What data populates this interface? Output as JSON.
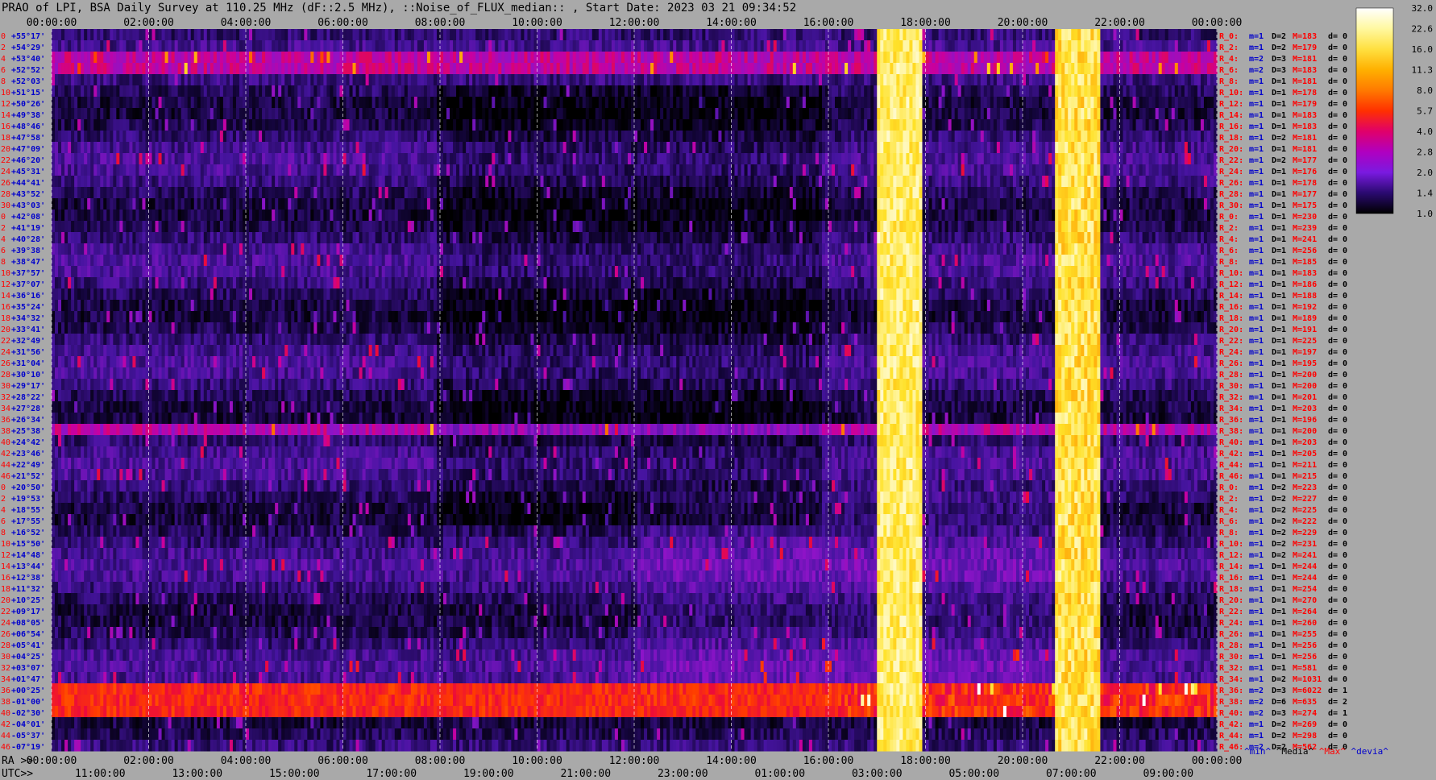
{
  "title": "PRAO of LPI, BSA Daily Survey at 110.25 MHz (dF::2.5 MHz), ::Noise_of_FLUX_median:: , Start Date: 2023 03 21 09:34:52",
  "colors": {
    "background": "#a9a9a9",
    "max_label": "#ff0000",
    "min_label": "#0000cc",
    "beam_number": "#ff0000",
    "dec_label": "#0000cc"
  },
  "chart_data": {
    "type": "heatmap",
    "top_axis_ticks": [
      "00:00:00",
      "02:00:00",
      "04:00:00",
      "06:00:00",
      "08:00:00",
      "10:00:00",
      "12:00:00",
      "14:00:00",
      "16:00:00",
      "18:00:00",
      "20:00:00",
      "22:00:00",
      "00:00:00"
    ],
    "ra_axis_prefix": "RA >>",
    "ra_axis_ticks": [
      "00:00:00",
      "02:00:00",
      "04:00:00",
      "06:00:00",
      "08:00:00",
      "10:00:00",
      "12:00:00",
      "14:00:00",
      "16:00:00",
      "18:00:00",
      "20:00:00",
      "22:00:00",
      "00:00:00"
    ],
    "utc_axis_prefix": "UTC>>",
    "utc_axis_ticks": [
      "11:00:00",
      "13:00:00",
      "15:00:00",
      "17:00:00",
      "19:00:00",
      "21:00:00",
      "23:00:00",
      "01:00:00",
      "03:00:00",
      "05:00:00",
      "07:00:00",
      "09:00:00"
    ],
    "colorbar": {
      "ticks": [
        "32.0",
        "22.6",
        "16.0",
        "11.3",
        "8.0",
        "5.7",
        "4.0",
        "2.8",
        "2.0",
        "1.4",
        "1.0"
      ],
      "colors": [
        "#ffffff",
        "#fff8a0",
        "#ffe040",
        "#ffb000",
        "#ff7a00",
        "#ff3000",
        "#e0006a",
        "#b000c0",
        "#7a1ae0",
        "#2a0a70",
        "#000000"
      ]
    },
    "declinations": [
      "+55°17'",
      "+54°29'",
      "+53°40'",
      "+52°52'",
      "+52°03'",
      "+51°15'",
      "+50°26'",
      "+49°38'",
      "+48°46'",
      "+47°58'",
      "+47°09'",
      "+46°20'",
      "+45°31'",
      "+44°41'",
      "+43°52'",
      "+43°03'",
      "+42°08'",
      "+41°19'",
      "+40°28'",
      "+39°38'",
      "+38°47'",
      "+37°57'",
      "+37°07'",
      "+36°16'",
      "+35°24'",
      "+34°32'",
      "+33°41'",
      "+32°49'",
      "+31°56'",
      "+31°04'",
      "+30°10'",
      "+29°17'",
      "+28°22'",
      "+27°28'",
      "+26°34'",
      "+25°38'",
      "+24°42'",
      "+23°46'",
      "+22°49'",
      "+21°52'",
      "+20°50'",
      "+19°53'",
      "+18°55'",
      "+17°55'",
      "+16°52'",
      "+15°50'",
      "+14°48'",
      "+13°44'",
      "+12°38'",
      "+11°32'",
      "+10°25'",
      "+09°17'",
      "+08°05'",
      "+06°54'",
      "+05°41'",
      "+04°25'",
      "+03°07'",
      "+01°47'",
      "+00°25'",
      "-01°00'",
      "-02°30'",
      "-04°01'",
      "-05°37'",
      "-07°19'"
    ],
    "beam_numbers": [
      "0",
      "2",
      "4",
      "6",
      "8",
      "10",
      "12",
      "14",
      "16",
      "18",
      "20",
      "22",
      "24",
      "26",
      "28",
      "30",
      "0",
      "2",
      "4",
      "6",
      "8",
      "10",
      "12",
      "14",
      "16",
      "18",
      "20",
      "22",
      "24",
      "26",
      "28",
      "30",
      "32",
      "34",
      "36",
      "38",
      "40",
      "42",
      "44",
      "46",
      "0",
      "2",
      "4",
      "6",
      "8",
      "10",
      "12",
      "14",
      "16",
      "18",
      "20",
      "22",
      "24",
      "26",
      "28",
      "30",
      "32",
      "34",
      "36",
      "38",
      "40",
      "42",
      "44",
      "46"
    ],
    "stats": [
      {
        "r": "R_0:",
        "m": "m=1",
        "D": "D=2",
        "M": "M=183",
        "d": "d= 0"
      },
      {
        "r": "R_2:",
        "m": "m=1",
        "D": "D=2",
        "M": "M=179",
        "d": "d= 0"
      },
      {
        "r": "R_4:",
        "m": "m=2",
        "D": "D=3",
        "M": "M=181",
        "d": "d= 0"
      },
      {
        "r": "R_6:",
        "m": "m=2",
        "D": "D=3",
        "M": "M=183",
        "d": "d= 0"
      },
      {
        "r": "R_8:",
        "m": "m=1",
        "D": "D=1",
        "M": "M=181",
        "d": "d= 0"
      },
      {
        "r": "R_10:",
        "m": "m=1",
        "D": "D=1",
        "M": "M=178",
        "d": "d= 0"
      },
      {
        "r": "R_12:",
        "m": "m=1",
        "D": "D=1",
        "M": "M=179",
        "d": "d= 0"
      },
      {
        "r": "R_14:",
        "m": "m=1",
        "D": "D=1",
        "M": "M=183",
        "d": "d= 0"
      },
      {
        "r": "R_16:",
        "m": "m=1",
        "D": "D=1",
        "M": "M=183",
        "d": "d= 0"
      },
      {
        "r": "R_18:",
        "m": "m=1",
        "D": "D=2",
        "M": "M=181",
        "d": "d= 0"
      },
      {
        "r": "R_20:",
        "m": "m=1",
        "D": "D=1",
        "M": "M=181",
        "d": "d= 0"
      },
      {
        "r": "R_22:",
        "m": "m=1",
        "D": "D=2",
        "M": "M=177",
        "d": "d= 0"
      },
      {
        "r": "R_24:",
        "m": "m=1",
        "D": "D=1",
        "M": "M=176",
        "d": "d= 0"
      },
      {
        "r": "R_26:",
        "m": "m=1",
        "D": "D=1",
        "M": "M=178",
        "d": "d= 0"
      },
      {
        "r": "R_28:",
        "m": "m=1",
        "D": "D=1",
        "M": "M=177",
        "d": "d= 0"
      },
      {
        "r": "R_30:",
        "m": "m=1",
        "D": "D=1",
        "M": "M=175",
        "d": "d= 0"
      },
      {
        "r": "R_0:",
        "m": "m=1",
        "D": "D=1",
        "M": "M=230",
        "d": "d= 0"
      },
      {
        "r": "R_2:",
        "m": "m=1",
        "D": "D=1",
        "M": "M=239",
        "d": "d= 0"
      },
      {
        "r": "R_4:",
        "m": "m=1",
        "D": "D=1",
        "M": "M=241",
        "d": "d= 0"
      },
      {
        "r": "R_6:",
        "m": "m=1",
        "D": "D=1",
        "M": "M=256",
        "d": "d= 0"
      },
      {
        "r": "R_8:",
        "m": "m=1",
        "D": "D=1",
        "M": "M=185",
        "d": "d= 0"
      },
      {
        "r": "R_10:",
        "m": "m=1",
        "D": "D=1",
        "M": "M=183",
        "d": "d= 0"
      },
      {
        "r": "R_12:",
        "m": "m=1",
        "D": "D=1",
        "M": "M=186",
        "d": "d= 0"
      },
      {
        "r": "R_14:",
        "m": "m=1",
        "D": "D=1",
        "M": "M=188",
        "d": "d= 0"
      },
      {
        "r": "R_16:",
        "m": "m=1",
        "D": "D=1",
        "M": "M=192",
        "d": "d= 0"
      },
      {
        "r": "R_18:",
        "m": "m=1",
        "D": "D=1",
        "M": "M=189",
        "d": "d= 0"
      },
      {
        "r": "R_20:",
        "m": "m=1",
        "D": "D=1",
        "M": "M=191",
        "d": "d= 0"
      },
      {
        "r": "R_22:",
        "m": "m=1",
        "D": "D=1",
        "M": "M=225",
        "d": "d= 0"
      },
      {
        "r": "R_24:",
        "m": "m=1",
        "D": "D=1",
        "M": "M=197",
        "d": "d= 0"
      },
      {
        "r": "R_26:",
        "m": "m=1",
        "D": "D=1",
        "M": "M=195",
        "d": "d= 0"
      },
      {
        "r": "R_28:",
        "m": "m=1",
        "D": "D=1",
        "M": "M=200",
        "d": "d= 0"
      },
      {
        "r": "R_30:",
        "m": "m=1",
        "D": "D=1",
        "M": "M=200",
        "d": "d= 0"
      },
      {
        "r": "R_32:",
        "m": "m=1",
        "D": "D=1",
        "M": "M=201",
        "d": "d= 0"
      },
      {
        "r": "R_34:",
        "m": "m=1",
        "D": "D=1",
        "M": "M=203",
        "d": "d= 0"
      },
      {
        "r": "R_36:",
        "m": "m=1",
        "D": "D=1",
        "M": "M=196",
        "d": "d= 0"
      },
      {
        "r": "R_38:",
        "m": "m=1",
        "D": "D=1",
        "M": "M=200",
        "d": "d= 0"
      },
      {
        "r": "R_40:",
        "m": "m=1",
        "D": "D=1",
        "M": "M=203",
        "d": "d= 0"
      },
      {
        "r": "R_42:",
        "m": "m=1",
        "D": "D=1",
        "M": "M=205",
        "d": "d= 0"
      },
      {
        "r": "R_44:",
        "m": "m=1",
        "D": "D=1",
        "M": "M=211",
        "d": "d= 0"
      },
      {
        "r": "R_46:",
        "m": "m=1",
        "D": "D=1",
        "M": "M=215",
        "d": "d= 0"
      },
      {
        "r": "R_0:",
        "m": "m=1",
        "D": "D=2",
        "M": "M=223",
        "d": "d= 0"
      },
      {
        "r": "R_2:",
        "m": "m=1",
        "D": "D=2",
        "M": "M=227",
        "d": "d= 0"
      },
      {
        "r": "R_4:",
        "m": "m=1",
        "D": "D=2",
        "M": "M=225",
        "d": "d= 0"
      },
      {
        "r": "R_6:",
        "m": "m=1",
        "D": "D=2",
        "M": "M=222",
        "d": "d= 0"
      },
      {
        "r": "R_8:",
        "m": "m=1",
        "D": "D=2",
        "M": "M=229",
        "d": "d= 0"
      },
      {
        "r": "R_10:",
        "m": "m=1",
        "D": "D=2",
        "M": "M=231",
        "d": "d= 0"
      },
      {
        "r": "R_12:",
        "m": "m=1",
        "D": "D=2",
        "M": "M=241",
        "d": "d= 0"
      },
      {
        "r": "R_14:",
        "m": "m=1",
        "D": "D=1",
        "M": "M=244",
        "d": "d= 0"
      },
      {
        "r": "R_16:",
        "m": "m=1",
        "D": "D=1",
        "M": "M=244",
        "d": "d= 0"
      },
      {
        "r": "R_18:",
        "m": "m=1",
        "D": "D=1",
        "M": "M=254",
        "d": "d= 0"
      },
      {
        "r": "R_20:",
        "m": "m=1",
        "D": "D=1",
        "M": "M=270",
        "d": "d= 0"
      },
      {
        "r": "R_22:",
        "m": "m=1",
        "D": "D=1",
        "M": "M=264",
        "d": "d= 0"
      },
      {
        "r": "R_24:",
        "m": "m=1",
        "D": "D=1",
        "M": "M=260",
        "d": "d= 0"
      },
      {
        "r": "R_26:",
        "m": "m=1",
        "D": "D=1",
        "M": "M=255",
        "d": "d= 0"
      },
      {
        "r": "R_28:",
        "m": "m=1",
        "D": "D=1",
        "M": "M=256",
        "d": "d= 0"
      },
      {
        "r": "R_30:",
        "m": "m=1",
        "D": "D=1",
        "M": "M=256",
        "d": "d= 0"
      },
      {
        "r": "R_32:",
        "m": "m=1",
        "D": "D=1",
        "M": "M=581",
        "d": "d= 0"
      },
      {
        "r": "R_34:",
        "m": "m=1",
        "D": "D=2",
        "M": "M=1031",
        "d": "d= 0"
      },
      {
        "r": "R_36:",
        "m": "m=2",
        "D": "D=3",
        "M": "M=6022",
        "d": "d= 1"
      },
      {
        "r": "R_38:",
        "m": "m=2",
        "D": "D=6",
        "M": "M=635",
        "d": "d= 2"
      },
      {
        "r": "R_40:",
        "m": "m=2",
        "D": "D=3",
        "M": "M=274",
        "d": "d= 1"
      },
      {
        "r": "R_42:",
        "m": "m=1",
        "D": "D=2",
        "M": "M=269",
        "d": "d= 0"
      },
      {
        "r": "R_44:",
        "m": "m=1",
        "D": "D=2",
        "M": "M=298",
        "d": "d= 0"
      },
      {
        "r": "R_46:",
        "m": "m=2",
        "D": "D=2",
        "M": "M=562",
        "d": "d= 0"
      }
    ],
    "stats_footer": {
      "min": "^min^",
      "median": "^Media^",
      "max": "^Max^",
      "devia": "^devia^"
    }
  }
}
